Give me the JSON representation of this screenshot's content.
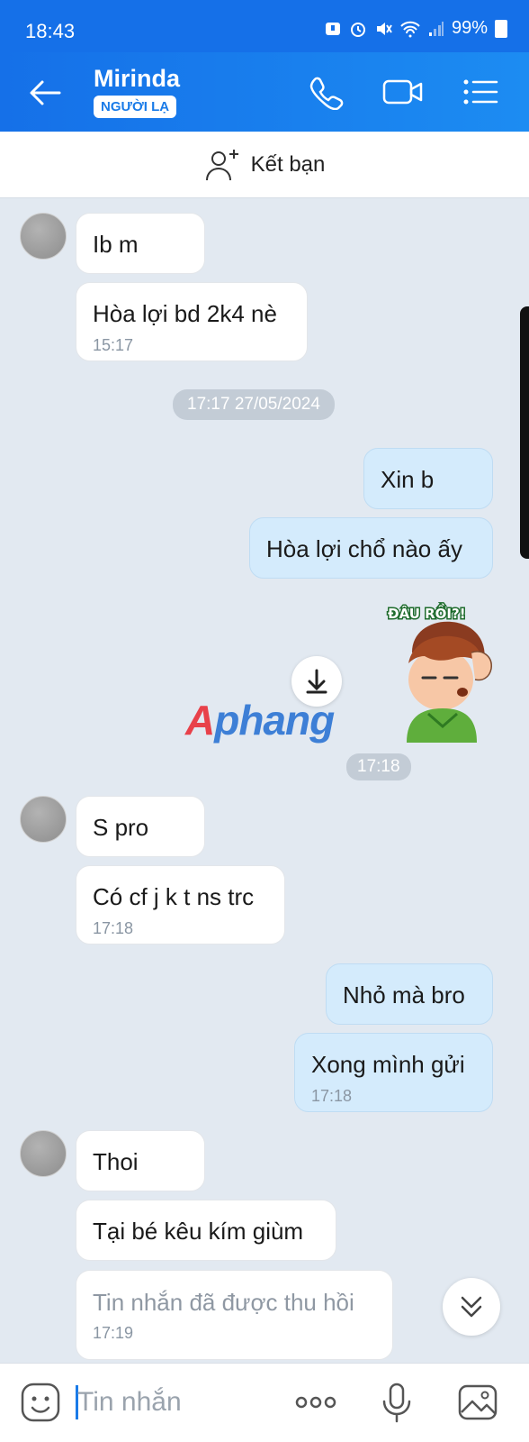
{
  "status_bar": {
    "time": "18:43",
    "battery": "99%"
  },
  "header": {
    "contact_name": "Mirinda",
    "badge": "NGƯỜI LẠ"
  },
  "friend_bar": {
    "label": "Kết bạn"
  },
  "messages": [
    {
      "dir": "in",
      "text": "Ib m"
    },
    {
      "dir": "in",
      "text": "Hòa lợi bd 2k4 nè",
      "time": "15:17"
    },
    {
      "dir": "date",
      "text": "17:17 27/05/2024"
    },
    {
      "dir": "out",
      "text": "Xin b"
    },
    {
      "dir": "out",
      "text": "Hòa lợi chổ nào ấy"
    },
    {
      "dir": "sticker",
      "caption": "ĐÂU RỒI?!"
    },
    {
      "dir": "time",
      "text": "17:18"
    },
    {
      "dir": "in",
      "text": "S pro"
    },
    {
      "dir": "in",
      "text": "Có cf j k t ns trc",
      "time": "17:18"
    },
    {
      "dir": "out",
      "text": "Nhỏ mà bro"
    },
    {
      "dir": "out",
      "text": "Xong mình gửi",
      "time": "17:18"
    },
    {
      "dir": "in",
      "text": "Thoi"
    },
    {
      "dir": "in",
      "text": "Tại bé kêu kím giùm"
    },
    {
      "dir": "in",
      "text": "Tin nhắn đã được thu hồi",
      "time": "17:19",
      "recalled": true
    }
  ],
  "watermark": {
    "text": "Aphang"
  },
  "composer": {
    "placeholder": "Tin nhắn"
  },
  "colors": {
    "header_blue": "#1570e8",
    "chat_bg": "#e2e9f1",
    "out_bubble": "#d4ebfc",
    "in_bubble": "#ffffff"
  },
  "icons": [
    "back-arrow-icon",
    "phone-icon",
    "video-call-icon",
    "menu-list-icon",
    "add-friend-icon",
    "download-icon",
    "chevron-double-down-icon",
    "emoji-icon",
    "more-dots-icon",
    "mic-icon",
    "image-icon"
  ]
}
